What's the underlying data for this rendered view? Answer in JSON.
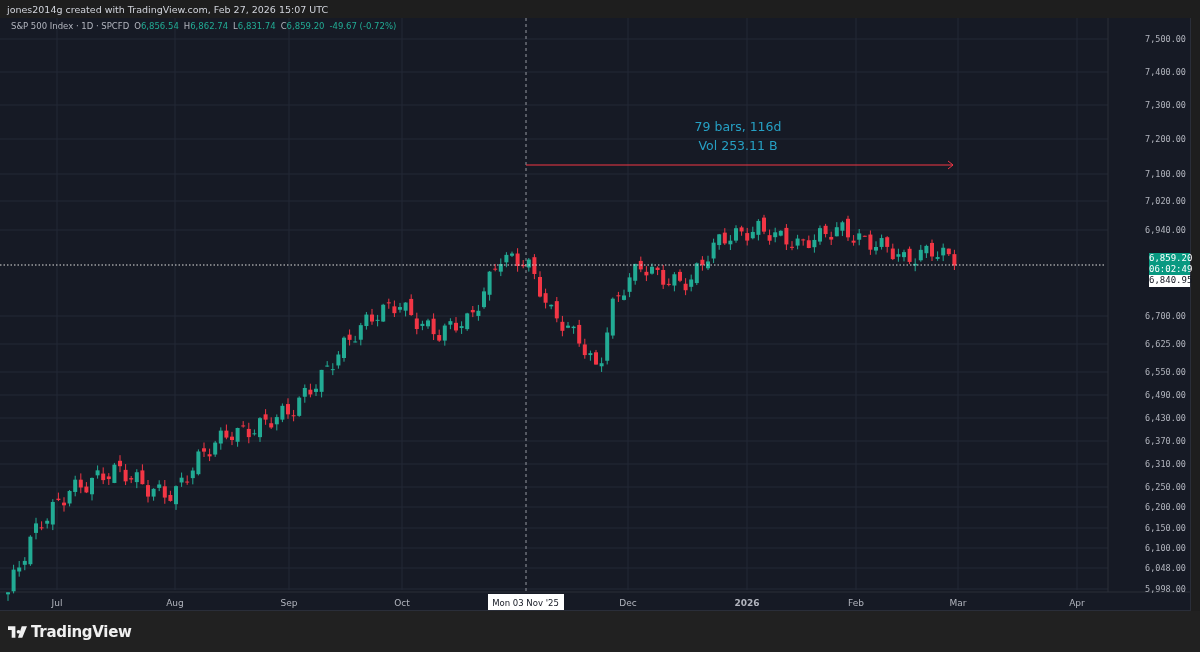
{
  "header": {
    "credit": "jones2014g created with TradingView.com, Feb 27, 2026 15:07 UTC"
  },
  "legend": {
    "title": "S&P 500 Index · 1D · SPCFD",
    "ohlc": [
      {
        "label": "O",
        "value": "6,856.54"
      },
      {
        "label": "H",
        "value": "6,862.74"
      },
      {
        "label": "L",
        "value": "6,831.74"
      },
      {
        "label": "C",
        "value": "6,859.20"
      }
    ],
    "change": "-49.67 (-0.72%)"
  },
  "measure": {
    "bars": "79 bars, 116d",
    "volume": "Vol 253.11 B"
  },
  "price_axis": [
    "7,500.00",
    "7,400.00",
    "7,300.00",
    "7,200.00",
    "7,100.00",
    "7,020.00",
    "6,940.00",
    "6,700.00",
    "6,625.00",
    "6,550.00",
    "6,490.00",
    "6,430.00",
    "6,370.00",
    "6,310.00",
    "6,250.00",
    "6,200.00",
    "6,150.00",
    "6,100.00",
    "6,048.00",
    "5,998.00"
  ],
  "price_tags": {
    "last_price": "6,859.20",
    "countdown": "06:02:49",
    "crosshair_price": "6,840.95"
  },
  "time_axis": [
    {
      "label": "Jul",
      "bold": false
    },
    {
      "label": "Aug",
      "bold": false
    },
    {
      "label": "Sep",
      "bold": false
    },
    {
      "label": "Oct",
      "bold": false
    },
    {
      "label": "Dec",
      "bold": false
    },
    {
      "label": "2026",
      "bold": true
    },
    {
      "label": "Feb",
      "bold": false
    },
    {
      "label": "Mar",
      "bold": false
    },
    {
      "label": "Apr",
      "bold": false
    }
  ],
  "crosshair_time": "Mon 03 Nov '25",
  "footer": {
    "brand": "TradingView"
  }
}
